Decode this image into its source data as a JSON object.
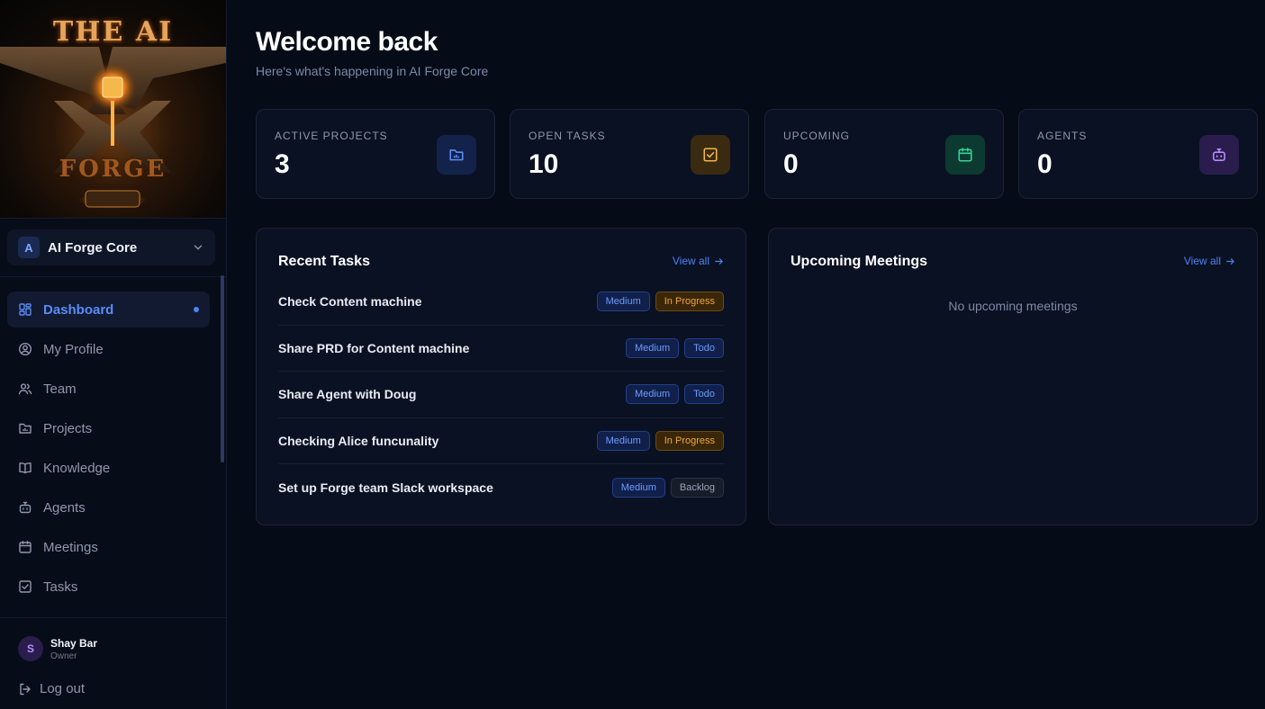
{
  "logo": {
    "top_text": "THE AI",
    "bottom_text": "FORGE"
  },
  "workspace": {
    "initial": "A",
    "name": "AI Forge Core"
  },
  "nav": {
    "items": [
      {
        "label": "Dashboard",
        "icon": "dashboard-icon",
        "active": true
      },
      {
        "label": "My Profile",
        "icon": "user-circle-icon"
      },
      {
        "label": "Team",
        "icon": "users-icon"
      },
      {
        "label": "Projects",
        "icon": "folder-icon"
      },
      {
        "label": "Knowledge",
        "icon": "book-icon"
      },
      {
        "label": "Agents",
        "icon": "bot-icon"
      },
      {
        "label": "Meetings",
        "icon": "calendar-icon"
      },
      {
        "label": "Tasks",
        "icon": "checkbox-icon"
      }
    ]
  },
  "user": {
    "initial": "S",
    "name": "Shay Bar",
    "role": "Owner"
  },
  "logout": {
    "label": "Log out"
  },
  "header": {
    "title": "Welcome back",
    "subtitle": "Here's what's happening in AI Forge Core"
  },
  "stats": [
    {
      "label": "ACTIVE PROJECTS",
      "value": "3",
      "icon": "folder-icon",
      "color": "#5b8bf7",
      "bg": "#13224a"
    },
    {
      "label": "OPEN TASKS",
      "value": "10",
      "icon": "checkbox-icon",
      "color": "#f0b44a",
      "bg": "#3a2b10"
    },
    {
      "label": "UPCOMING",
      "value": "0",
      "icon": "calendar-icon",
      "color": "#34d399",
      "bg": "#0c3a30"
    },
    {
      "label": "AGENTS",
      "value": "0",
      "icon": "bot-icon",
      "color": "#b88cff",
      "bg": "#2a1d4d"
    }
  ],
  "recent_tasks": {
    "title": "Recent Tasks",
    "view_all": "View all",
    "items": [
      {
        "title": "Check Content machine",
        "priority": "Medium",
        "status": "In Progress"
      },
      {
        "title": "Share PRD for Content machine",
        "priority": "Medium",
        "status": "Todo"
      },
      {
        "title": "Share Agent with Doug",
        "priority": "Medium",
        "status": "Todo"
      },
      {
        "title": "Checking Alice funcunality",
        "priority": "Medium",
        "status": "In Progress"
      },
      {
        "title": "Set up Forge team Slack workspace",
        "priority": "Medium",
        "status": "Backlog"
      }
    ]
  },
  "meetings": {
    "title": "Upcoming Meetings",
    "view_all": "View all",
    "empty": "No upcoming meetings"
  }
}
